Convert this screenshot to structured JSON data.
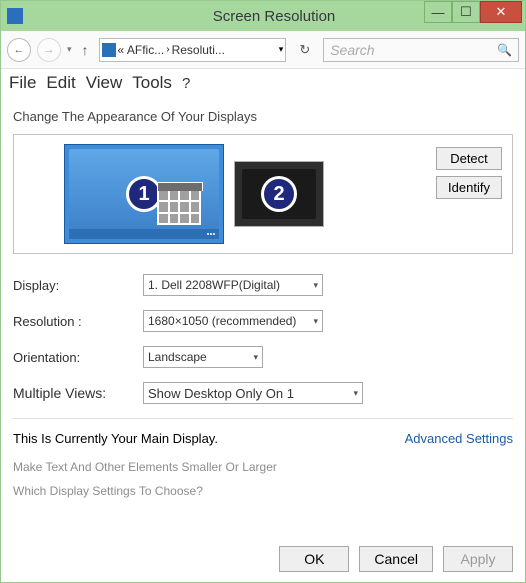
{
  "window": {
    "title": "Screen Resolution"
  },
  "toolbar": {
    "path_prefix": "« AFfic...",
    "path_current": "Resoluti...",
    "search_placeholder": "Search"
  },
  "menubar": {
    "file": "File",
    "edit": "Edit",
    "view": "View",
    "tools": "Tools",
    "help": "?"
  },
  "content": {
    "heading": "Change The Appearance Of Your Displays",
    "detect_label": "Detect",
    "identify_label": "Identify",
    "monitor1_num": "1",
    "monitor2_num": "2",
    "display_label": "Display:",
    "display_value": "1. Dell 2208WFP(Digital)",
    "resolution_label": "Resolution :",
    "resolution_value": "1680×1050 (recommended)",
    "orientation_label": "Orientation:",
    "orientation_value": "Landscape",
    "views_label": "Multiple Views:",
    "views_value": "Show Desktop Only On 1",
    "main_display_text": "This Is Currently Your Main Display.",
    "advanced_link": "Advanced Settings",
    "text_size_link": "Make Text And Other Elements Smaller Or Larger",
    "which_settings_link": "Which Display Settings To Choose?"
  },
  "footer": {
    "ok": "OK",
    "cancel": "Cancel",
    "apply": "Apply"
  }
}
